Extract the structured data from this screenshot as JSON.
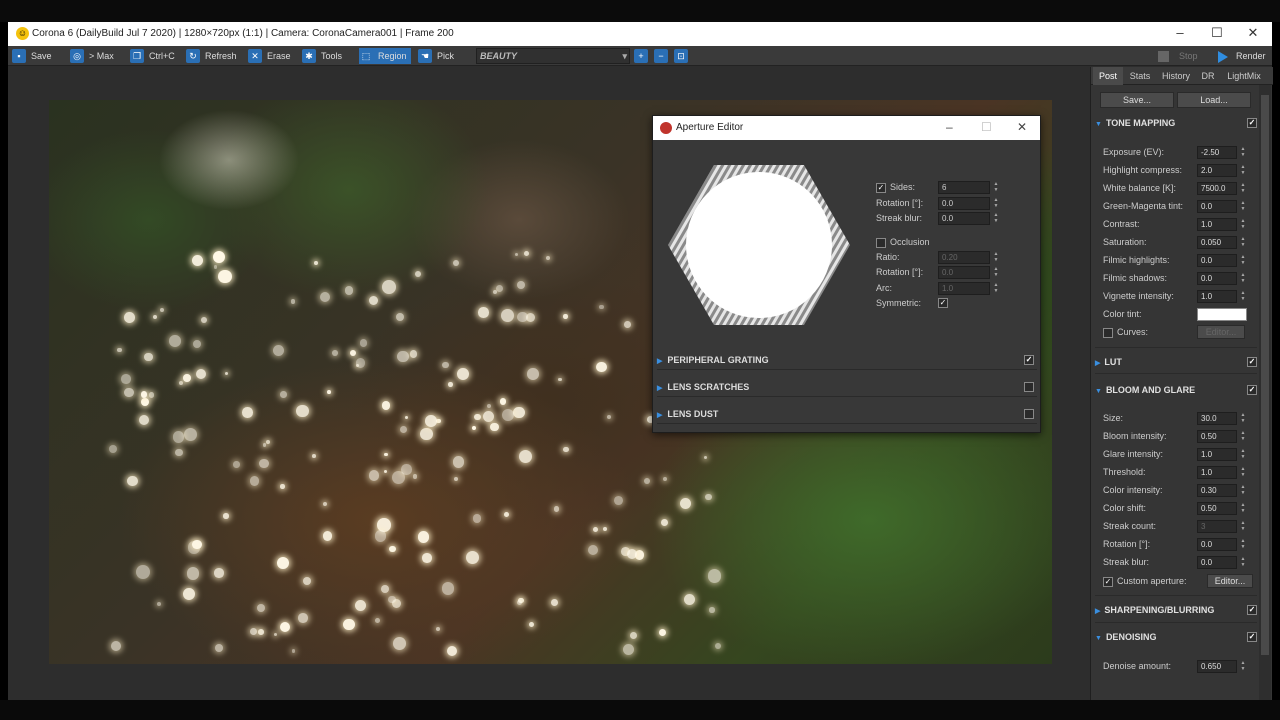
{
  "window": {
    "title": "Corona 6 (DailyBuild Jul  7 2020) | 1280×720px (1:1) | Camera: CoronaCamera001 | Frame 200"
  },
  "toolbar": {
    "save": "Save",
    "max": "> Max",
    "ctrlc": "Ctrl+C",
    "refresh": "Refresh",
    "erase": "Erase",
    "tools": "Tools",
    "region": "Region",
    "pick": "Pick",
    "channel": "BEAUTY",
    "stop": "Stop",
    "render": "Render"
  },
  "panel": {
    "tabs": [
      "Post",
      "Stats",
      "History",
      "DR",
      "LightMix"
    ],
    "save_btn": "Save...",
    "load_btn": "Load...",
    "tone": {
      "header": "TONE MAPPING",
      "rows": [
        {
          "label": "Exposure (EV):",
          "value": "-2.50"
        },
        {
          "label": "Highlight compress:",
          "value": "2.0"
        },
        {
          "label": "White balance [K]:",
          "value": "7500.0"
        },
        {
          "label": "Green-Magenta tint:",
          "value": "0.0"
        },
        {
          "label": "Contrast:",
          "value": "1.0"
        },
        {
          "label": "Saturation:",
          "value": "0.050"
        },
        {
          "label": "Filmic highlights:",
          "value": "0.0"
        },
        {
          "label": "Filmic shadows:",
          "value": "0.0"
        },
        {
          "label": "Vignette intensity:",
          "value": "1.0"
        }
      ],
      "color_tint": "Color tint:",
      "curves": "Curves:",
      "curves_btn": "Editor..."
    },
    "lut": {
      "header": "LUT"
    },
    "bloom": {
      "header": "BLOOM AND GLARE",
      "rows": [
        {
          "label": "Size:",
          "value": "30.0"
        },
        {
          "label": "Bloom intensity:",
          "value": "0.50"
        },
        {
          "label": "Glare intensity:",
          "value": "1.0"
        },
        {
          "label": "Threshold:",
          "value": "1.0"
        },
        {
          "label": "Color intensity:",
          "value": "0.30"
        },
        {
          "label": "Color shift:",
          "value": "0.50"
        },
        {
          "label": "Streak count:",
          "value": "3"
        },
        {
          "label": "Rotation [°]:",
          "value": "0.0"
        },
        {
          "label": "Streak blur:",
          "value": "0.0"
        }
      ],
      "custom_aperture": "Custom aperture:",
      "editor_btn": "Editor..."
    },
    "sharpen": {
      "header": "SHARPENING/BLURRING"
    },
    "denoise": {
      "header": "DENOISING",
      "label": "Denoise amount:",
      "value": "0.650"
    }
  },
  "dialog": {
    "title": "Aperture Editor",
    "sides_label": "Sides:",
    "sides": "6",
    "rotation_label": "Rotation [°]:",
    "rotation": "0.0",
    "streak_label": "Streak blur:",
    "streak": "0.0",
    "occlusion": "Occlusion",
    "ratio_label": "Ratio:",
    "ratio": "0.20",
    "rotation2_label": "Rotation [°]:",
    "rotation2": "0.0",
    "arc_label": "Arc:",
    "arc": "1.0",
    "symmetric": "Symmetric:",
    "sections": [
      "PERIPHERAL GRATING",
      "LENS SCRATCHES",
      "LENS DUST"
    ]
  }
}
